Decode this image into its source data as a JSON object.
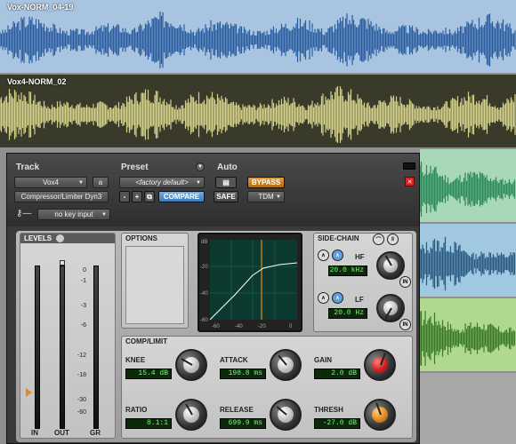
{
  "tracks": [
    {
      "name": "Vox-NORM_04-19",
      "color": "#a8c4e0",
      "wave": "#2a5ea0"
    },
    {
      "name": "Vox4-NORM_02",
      "color": "#3a3a2a",
      "wave": "#d4d28a"
    }
  ],
  "plugin": {
    "track_label": "Track",
    "track_name": "Vox4",
    "track_channel": "a",
    "plugin_name": "Compressor/Limiter Dyn3",
    "preset_label": "Preset",
    "preset_name": "<factory default>",
    "compare_label": "COMPARE",
    "auto_label": "Auto",
    "safe_label": "SAFE",
    "bypass_label": "BYPASS",
    "format_label": "TDM",
    "key_input": "no key input",
    "key_icon": "key-icon",
    "levels": {
      "title": "LEVELS",
      "scale": [
        "0",
        "-1",
        "-3",
        "-6",
        "-12",
        "-18",
        "-30",
        "-60"
      ],
      "meter_labels": [
        "IN",
        "OUT",
        "GR"
      ]
    },
    "options": {
      "title": "OPTIONS"
    },
    "graph": {
      "unit": "dB",
      "y_ticks": [
        "-20",
        "-40",
        "-60"
      ],
      "x_ticks": [
        "-60",
        "-40",
        "-20",
        "0"
      ]
    },
    "sidechain": {
      "title": "SIDE-CHAIN",
      "hf_label": "HF",
      "hf_value": "20.0 kHz",
      "lf_label": "LF",
      "lf_value": "20.0 Hz",
      "in_label": "IN"
    },
    "complimit": {
      "title": "COMP/LIMIT",
      "knee_label": "KNEE",
      "knee_value": "15.4 dB",
      "attack_label": "ATTACK",
      "attack_value": "198.8 ms",
      "gain_label": "GAIN",
      "gain_value": "2.0 dB",
      "ratio_label": "RATIO",
      "ratio_value": "8.1:1",
      "release_label": "RELEASE",
      "release_value": "699.9 ms",
      "thresh_label": "THRESH",
      "thresh_value": "-27.0 dB"
    }
  }
}
